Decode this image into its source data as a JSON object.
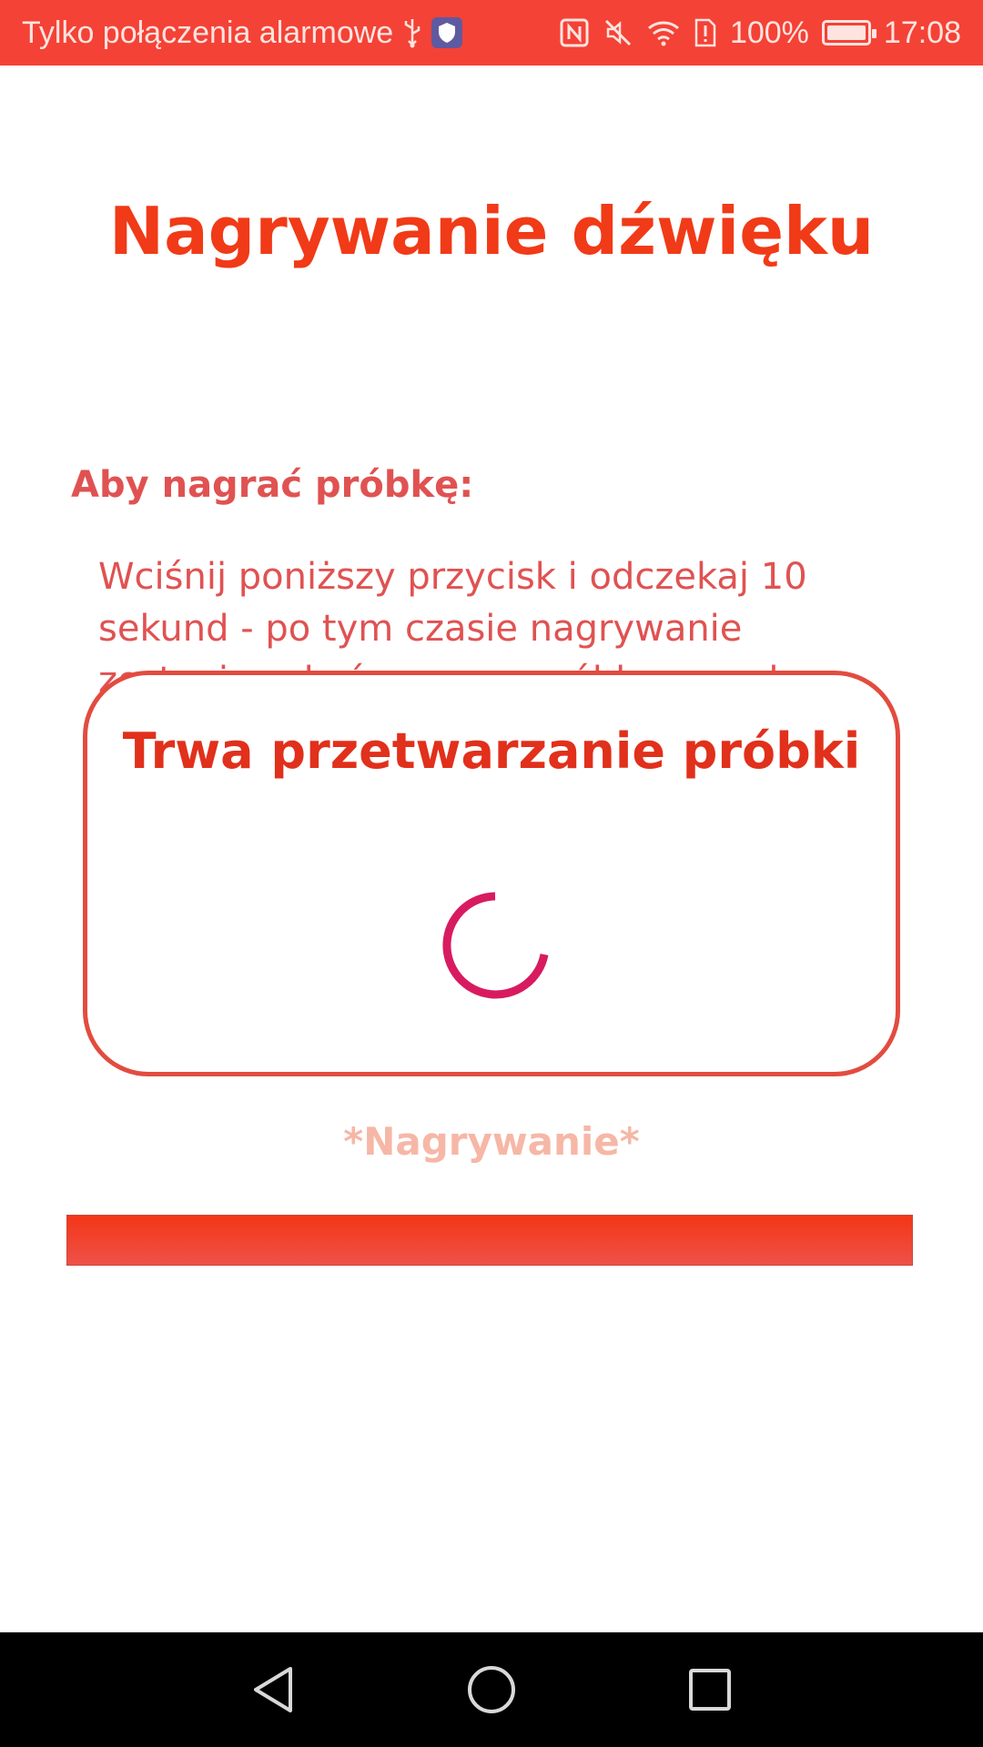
{
  "status_bar": {
    "carrier_text": "Tylko połączenia alarmowe",
    "battery_percent": "100%",
    "time": "17:08",
    "icons": [
      "usb-icon",
      "shield-icon",
      "nfc-icon",
      "mute-icon",
      "wifi-icon",
      "sim-alert-icon",
      "battery-charging-icon"
    ]
  },
  "page": {
    "title": "Nagrywanie dźwięku",
    "instruction_heading": "Aby nagrać próbkę:",
    "instruction_text": "Wciśnij poniższy przycisk i odczekaj 10 sekund - po tym czasie nagrywanie zostanie zakończone, a próbka przesłana do analizy"
  },
  "dialog": {
    "title": "Trwa przetwarzanie próbki",
    "spinner_color": "#d81b60"
  },
  "recording": {
    "label": "*Nagrywanie*"
  },
  "colors": {
    "accent": "#f13a17",
    "status_bar": "#f44236",
    "text_secondary": "#e05252"
  },
  "nav_bar": {
    "icons": [
      "back-icon",
      "home-icon",
      "recents-icon"
    ]
  }
}
